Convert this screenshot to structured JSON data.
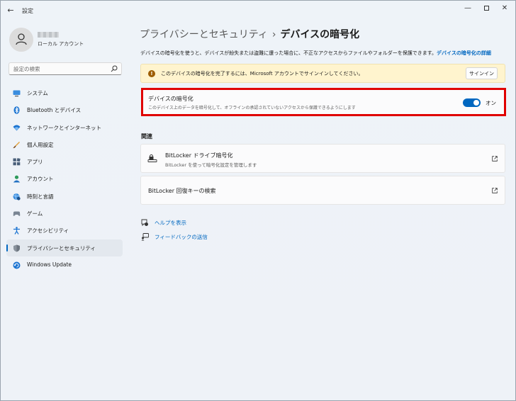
{
  "app": {
    "title": "設定",
    "back": "←",
    "minimize": "—",
    "close": "✕"
  },
  "profile": {
    "account_type": "ローカル アカウント"
  },
  "search": {
    "placeholder": "設定の検索"
  },
  "sidebar": {
    "items": [
      {
        "label": "システム",
        "icon": "monitor-icon"
      },
      {
        "label": "Bluetooth とデバイス",
        "icon": "bluetooth-icon"
      },
      {
        "label": "ネットワークとインターネット",
        "icon": "wifi-icon"
      },
      {
        "label": "個人用設定",
        "icon": "brush-icon"
      },
      {
        "label": "アプリ",
        "icon": "apps-icon"
      },
      {
        "label": "アカウント",
        "icon": "person-icon"
      },
      {
        "label": "時刻と言語",
        "icon": "globe-clock-icon"
      },
      {
        "label": "ゲーム",
        "icon": "gamepad-icon"
      },
      {
        "label": "アクセシビリティ",
        "icon": "accessibility-icon"
      },
      {
        "label": "プライバシーとセキュリティ",
        "icon": "shield-icon",
        "active": true
      },
      {
        "label": "Windows Update",
        "icon": "update-icon"
      }
    ]
  },
  "breadcrumb": {
    "parent": "プライバシーとセキュリティ",
    "separator": "›",
    "current": "デバイスの暗号化"
  },
  "description": {
    "text": "デバイスの暗号化を使うと、デバイスが紛失または盗難に遭った場合に、不正なアクセスからファイルやフォルダーを保護できます。",
    "link": "デバイスの暗号化の詳細"
  },
  "warning": {
    "icon": "!",
    "text": "このデバイスの暗号化を完了するには、Microsoft アカウントでサインインしてください。",
    "button": "サインイン"
  },
  "encryption": {
    "title": "デバイスの暗号化",
    "subtitle": "このデバイス上のデータを暗号化して、オフラインの承認されていないアクセスから保護できるようにします",
    "toggle_state": "オン",
    "toggle_on": true
  },
  "related": {
    "heading": "関連",
    "cards": [
      {
        "title": "BitLocker ドライブ暗号化",
        "subtitle": "BitLocker を使って暗号化設定を管理します"
      },
      {
        "title": "BitLocker 回復キーの検索"
      }
    ]
  },
  "links": {
    "help": "ヘルプを表示",
    "feedback": "フィードバックの送信"
  },
  "colors": {
    "accent": "#0067c0",
    "warning_bg": "#fff4ce",
    "highlight_border": "#e00000"
  }
}
